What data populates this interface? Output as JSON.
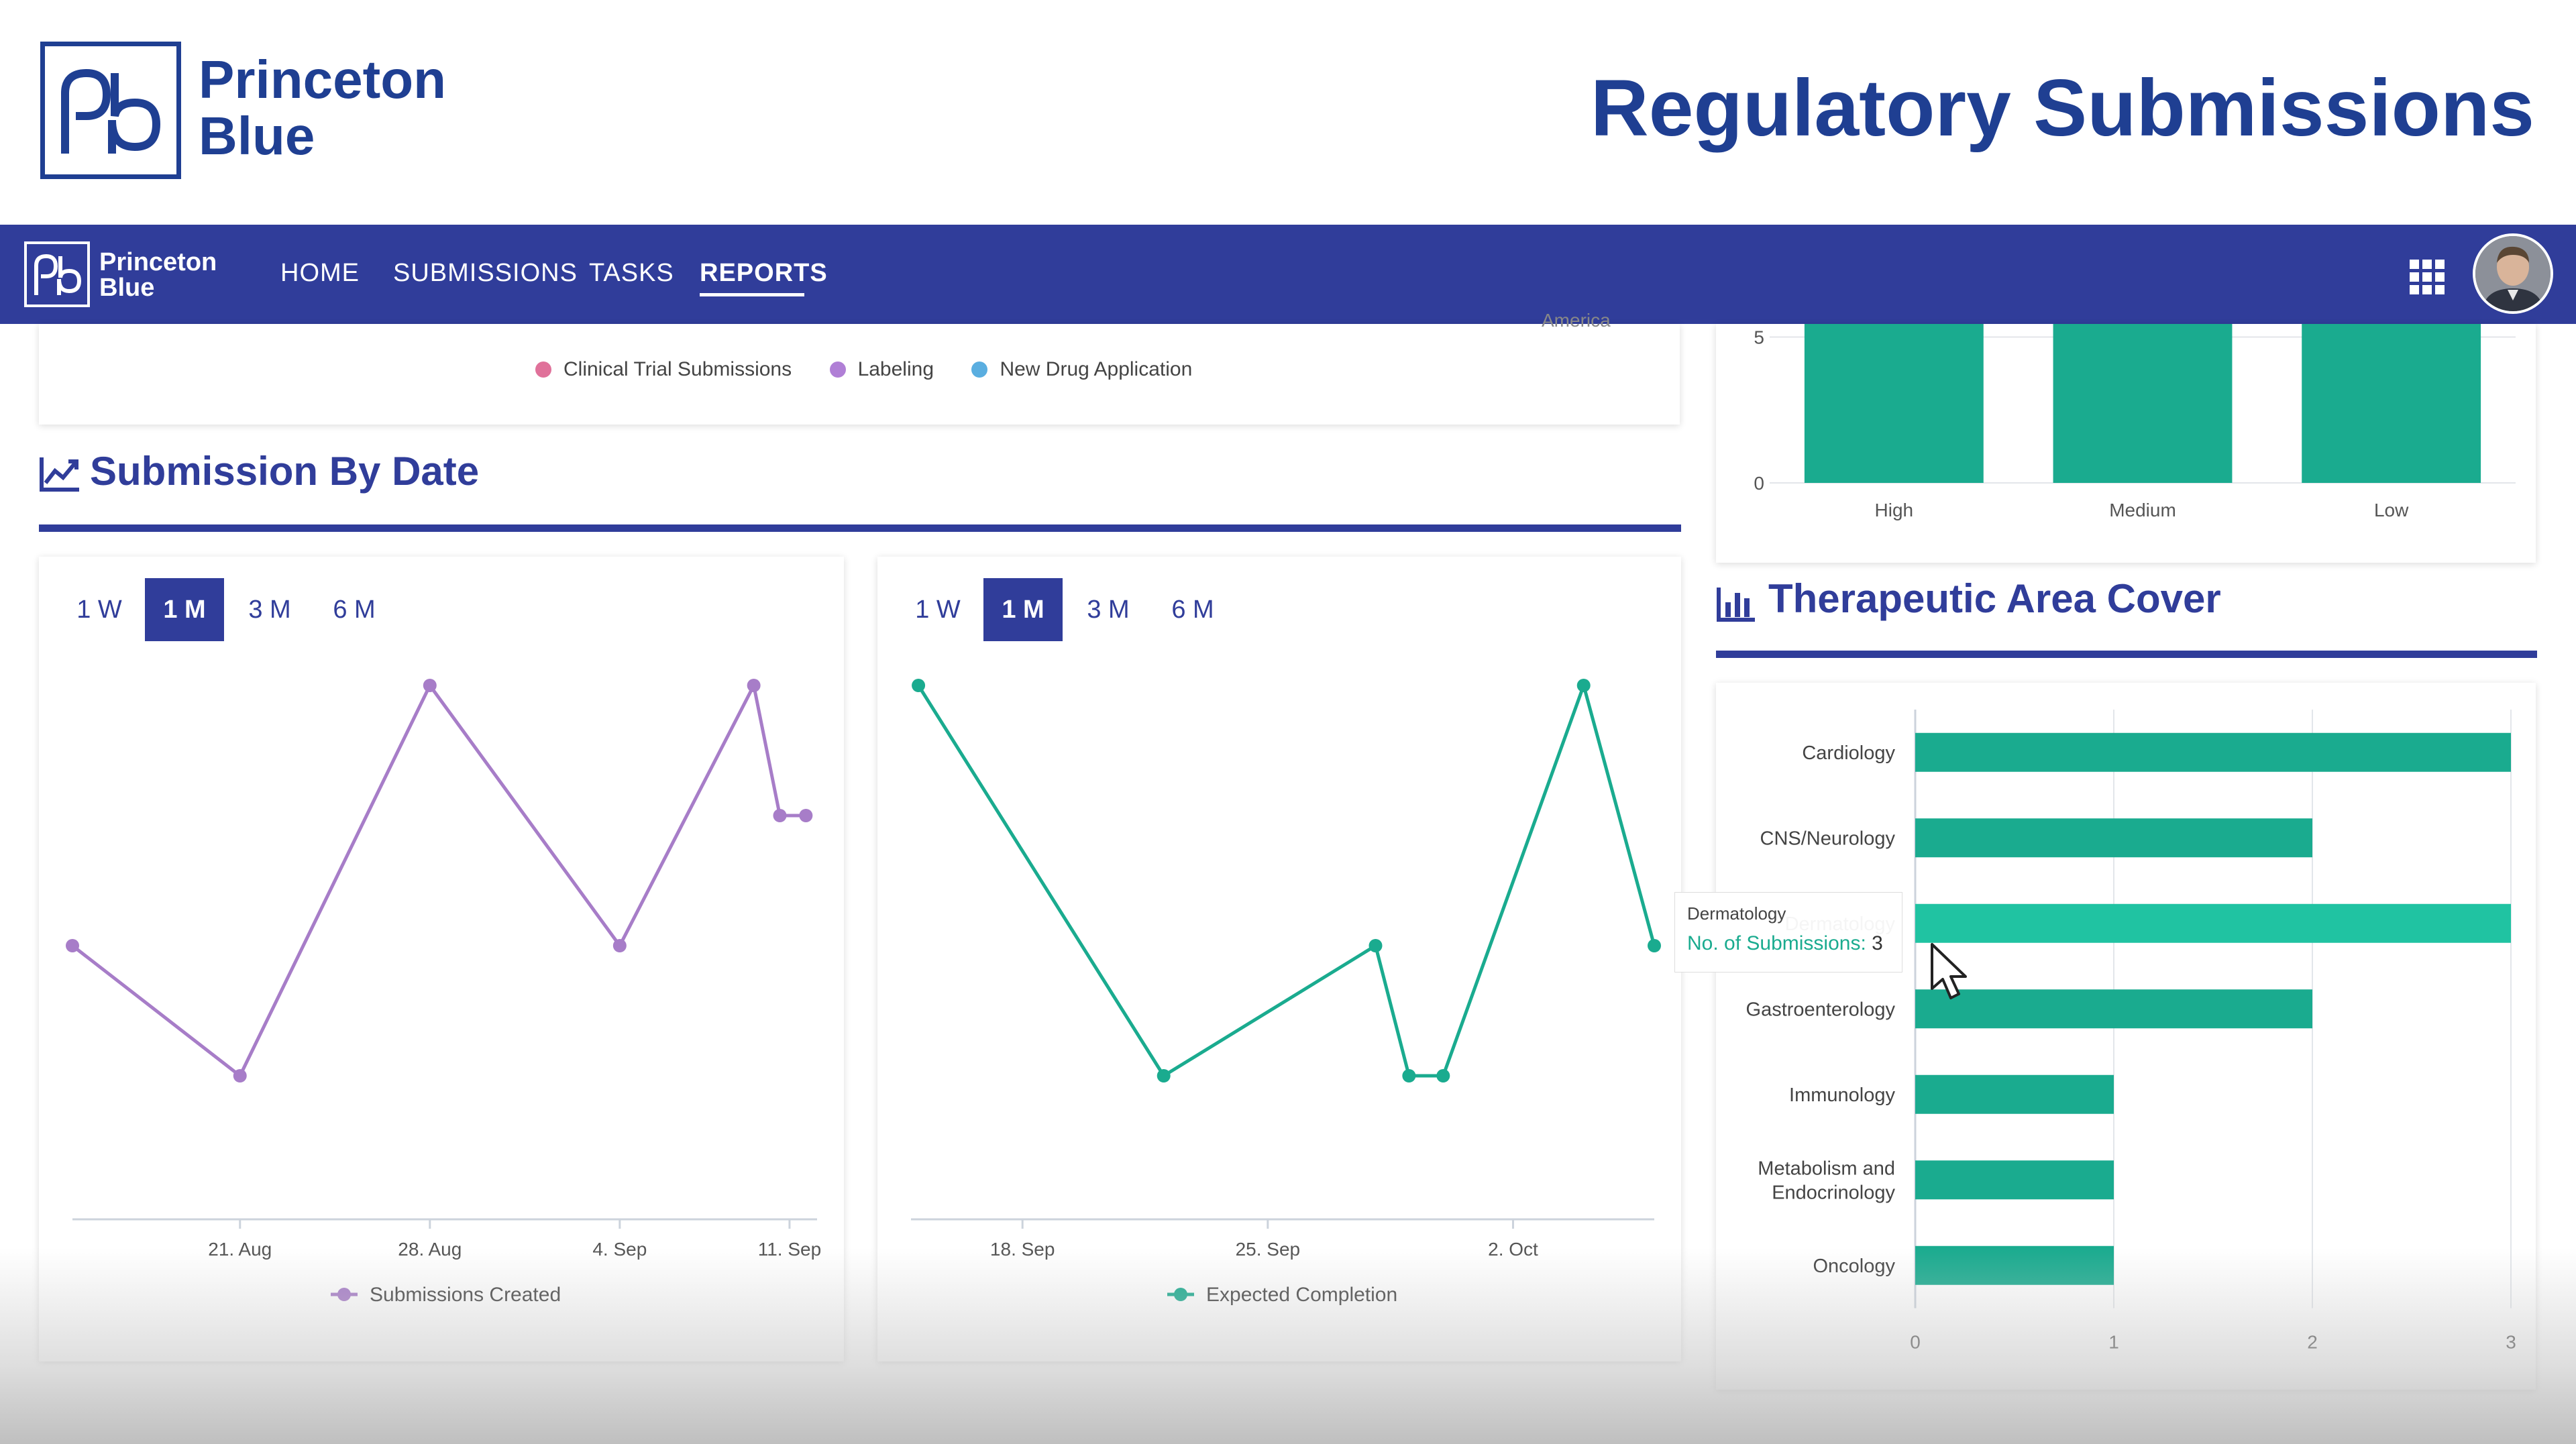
{
  "header": {
    "brand_line1": "Princeton",
    "brand_line2": "Blue",
    "page_title": "Regulatory Submissions"
  },
  "nav": {
    "brand_line1": "Princeton",
    "brand_line2": "Blue",
    "items": [
      {
        "label": "HOME",
        "active": false
      },
      {
        "label": "SUBMISSIONS",
        "active": false
      },
      {
        "label": "TASKS",
        "active": false
      },
      {
        "label": "REPORTS",
        "active": true
      }
    ]
  },
  "top_card": {
    "clipped_text": "America",
    "legend": [
      {
        "label": "Clinical Trial Submissions",
        "color": "#e0719a"
      },
      {
        "label": "Labeling",
        "color": "#b07fd6"
      },
      {
        "label": "New Drug Application",
        "color": "#5aaee0"
      }
    ]
  },
  "submission_by_date": {
    "title": "Submission By Date",
    "icon": "line-chart-icon"
  },
  "left_tabs": [
    "1 W",
    "1 M",
    "3 M",
    "6 M"
  ],
  "right_tabs": [
    "1 W",
    "1 M",
    "3 M",
    "6 M"
  ],
  "therapeutic": {
    "title": "Therapeutic Area Cover",
    "icon": "bar-chart-icon"
  },
  "tooltip": {
    "category": "Dermatology",
    "label": "No. of Submissions:",
    "value": "3"
  },
  "colors": {
    "brand": "#303d9a",
    "teal": "#1aab8f",
    "teal_highlight": "#20c3a2",
    "purple": "#a77dc8"
  },
  "chart_data": [
    {
      "type": "line",
      "title": "",
      "series": [
        {
          "name": "Submissions Created",
          "color": "#a77dc8",
          "values": [
            2,
            1,
            4,
            2,
            4,
            3,
            3
          ]
        }
      ],
      "x": [
        "",
        "21. Aug",
        "28. Aug",
        "4. Sep",
        "11. Sep",
        "",
        ""
      ],
      "x_ticks": [
        "21. Aug",
        "28. Aug",
        "4. Sep",
        "11. Sep"
      ],
      "ylim": [
        0,
        4
      ],
      "grid": false,
      "legend": "bottom"
    },
    {
      "type": "line",
      "title": "",
      "series": [
        {
          "name": "Expected Completion",
          "color": "#1aab8f",
          "values": [
            4,
            1,
            2,
            1,
            1,
            4,
            2
          ]
        }
      ],
      "x_ticks": [
        "18. Sep",
        "25. Sep",
        "2. Oct"
      ],
      "ylim": [
        0,
        4
      ],
      "grid": false,
      "legend": "bottom"
    },
    {
      "type": "bar",
      "title": "",
      "categories": [
        "High",
        "Medium",
        "Low"
      ],
      "values": [
        6,
        7,
        6
      ],
      "y_ticks": [
        "0",
        "5"
      ],
      "ylim": [
        0,
        7
      ],
      "grid": true
    },
    {
      "type": "bar",
      "orientation": "horizontal",
      "title": "",
      "categories": [
        "Cardiology",
        "CNS/Neurology",
        "Dermatology",
        "Gastroenterology",
        "Immunology",
        "Metabolism and Endocrinology",
        "Oncology"
      ],
      "values": [
        3,
        2,
        3,
        2,
        1,
        1,
        1
      ],
      "x_ticks": [
        "0",
        "1",
        "2",
        "3"
      ],
      "xlim": [
        0,
        3
      ],
      "grid": true
    }
  ]
}
